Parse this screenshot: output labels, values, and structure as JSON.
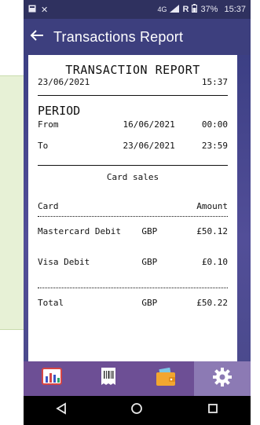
{
  "status_bar": {
    "network_type": "4G",
    "signal_label": "R",
    "battery_pct": "37%",
    "time": "15:37"
  },
  "app_bar": {
    "back_icon": "arrow-left-icon",
    "title": "Transactions Report"
  },
  "receipt": {
    "title": "TRANSACTION REPORT",
    "date": "23/06/2021",
    "time": "15:37",
    "period_label": "PERIOD",
    "from_label": "From",
    "from_date": "16/06/2021",
    "from_time": "00:00",
    "to_label": "To",
    "to_date": "23/06/2021",
    "to_time": "23:59",
    "section_title": "Card sales",
    "col_card": "Card",
    "col_amount": "Amount",
    "items": [
      {
        "card": "Mastercard Debit",
        "currency": "GBP",
        "amount": "£50.12"
      },
      {
        "card": "Visa Debit",
        "currency": "GBP",
        "amount": "£0.10"
      }
    ],
    "total_label": "Total",
    "total_currency": "GBP",
    "total_amount": "£50.22"
  },
  "bottom_nav": {
    "items": [
      {
        "icon": "bar-chart-icon",
        "active": false
      },
      {
        "icon": "receipt-barcode-icon",
        "active": false
      },
      {
        "icon": "wallet-icon",
        "active": false
      },
      {
        "icon": "gear-icon",
        "active": true
      }
    ]
  },
  "system_nav": {
    "back": "back-triangle-icon",
    "home": "home-circle-icon",
    "recents": "recents-square-icon"
  }
}
